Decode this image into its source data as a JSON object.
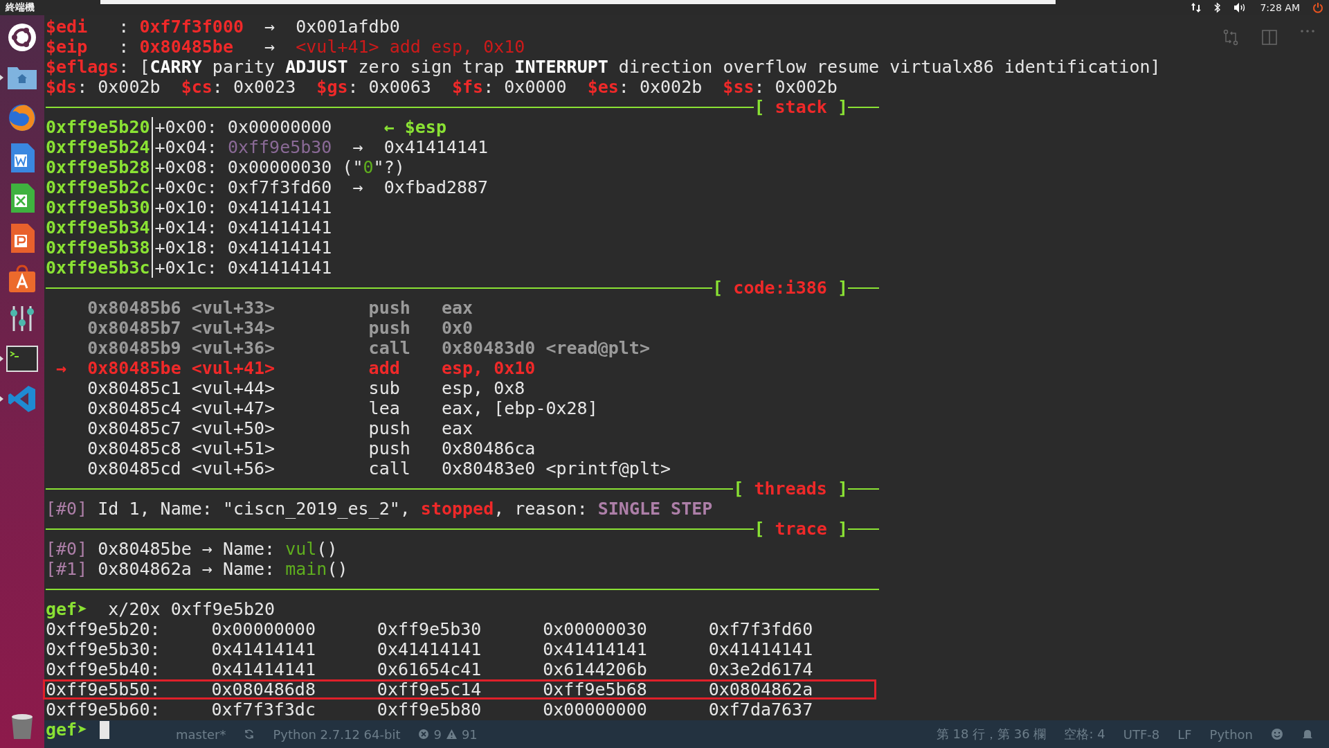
{
  "top_bar": {
    "title": "終端機",
    "clock": "7:28 AM"
  },
  "dock": [
    {
      "kind": "ubuntu",
      "running": false
    },
    {
      "kind": "files",
      "running": true
    },
    {
      "kind": "browser",
      "running": false
    },
    {
      "kind": "writer",
      "running": false
    },
    {
      "kind": "sheet",
      "running": false
    },
    {
      "kind": "slides",
      "running": false
    },
    {
      "kind": "store",
      "running": false
    },
    {
      "kind": "mixer",
      "running": false
    },
    {
      "kind": "terminal",
      "running": true
    },
    {
      "kind": "code",
      "running": true
    },
    {
      "kind": "trash",
      "running": false
    }
  ],
  "terminal": {
    "lines": [
      {
        "kind": "text",
        "segments": [
          {
            "t": "$edi",
            "kind": "reg"
          },
          {
            "t": "   : ",
            "kind": "val"
          },
          {
            "t": "0xf7f3f000",
            "kind": "reg"
          },
          {
            "t": "  →  ",
            "kind": "val"
          },
          {
            "t": "0x001afdb0",
            "kind": "val"
          }
        ]
      },
      {
        "kind": "text",
        "segments": [
          {
            "t": "$eip",
            "kind": "reg"
          },
          {
            "t": "   : ",
            "kind": "val"
          },
          {
            "t": "0x80485be",
            "kind": "reg"
          },
          {
            "t": "   →  ",
            "kind": "val"
          },
          {
            "t": "<vul+41> add esp, 0x10",
            "kind": "dred"
          }
        ]
      },
      {
        "kind": "text",
        "segments": [
          {
            "t": "$eflags",
            "kind": "reg"
          },
          {
            "t": ": [",
            "kind": "val"
          },
          {
            "t": "CARRY",
            "kind": "bold"
          },
          {
            "t": " parity ",
            "kind": "val"
          },
          {
            "t": "ADJUST",
            "kind": "bold"
          },
          {
            "t": " zero sign trap ",
            "kind": "val"
          },
          {
            "t": "INTERRUPT",
            "kind": "bold"
          },
          {
            "t": " direction overflow resume virtualx86 identification]",
            "kind": "val"
          }
        ]
      },
      {
        "kind": "text",
        "segments": [
          {
            "t": "$ds",
            "kind": "reg"
          },
          {
            "t": ": 0x002b  ",
            "kind": "val"
          },
          {
            "t": "$cs",
            "kind": "reg"
          },
          {
            "t": ": 0x0023  ",
            "kind": "val"
          },
          {
            "t": "$gs",
            "kind": "reg"
          },
          {
            "t": ": 0x0063  ",
            "kind": "val"
          },
          {
            "t": "$fs",
            "kind": "reg"
          },
          {
            "t": ": 0x0000  ",
            "kind": "val"
          },
          {
            "t": "$es",
            "kind": "reg"
          },
          {
            "t": ": 0x002b  ",
            "kind": "val"
          },
          {
            "t": "$ss",
            "kind": "reg"
          },
          {
            "t": ": 0x002b",
            "kind": "val"
          }
        ]
      },
      {
        "kind": "separator",
        "open": "[",
        "title": "stack",
        "close": "]"
      },
      {
        "kind": "stack",
        "address": "0xff9e5b20",
        "segments": [
          {
            "t": "+0x00: 0x00000000     ",
            "kind": "val"
          },
          {
            "t": "← $esp",
            "kind": "addr"
          }
        ]
      },
      {
        "kind": "stack",
        "address": "0xff9e5b24",
        "segments": [
          {
            "t": "+0x04: ",
            "kind": "val"
          },
          {
            "t": "0xff9e5b30",
            "kind": "ptr"
          },
          {
            "t": "  →  0x41414141",
            "kind": "val"
          }
        ]
      },
      {
        "kind": "stack",
        "address": "0xff9e5b28",
        "segments": [
          {
            "t": "+0x08: 0x00000030 (\"",
            "kind": "val"
          },
          {
            "t": "0",
            "kind": "str"
          },
          {
            "t": "\"?)",
            "kind": "val"
          }
        ]
      },
      {
        "kind": "stack",
        "address": "0xff9e5b2c",
        "segments": [
          {
            "t": "+0x0c: 0xf7f3fd60  →  0xfbad2887",
            "kind": "val"
          }
        ]
      },
      {
        "kind": "stack",
        "address": "0xff9e5b30",
        "segments": [
          {
            "t": "+0x10: 0x41414141",
            "kind": "val"
          }
        ]
      },
      {
        "kind": "stack",
        "address": "0xff9e5b34",
        "segments": [
          {
            "t": "+0x14: 0x41414141",
            "kind": "val"
          }
        ]
      },
      {
        "kind": "stack",
        "address": "0xff9e5b38",
        "segments": [
          {
            "t": "+0x18: 0x41414141",
            "kind": "val"
          }
        ]
      },
      {
        "kind": "stack",
        "address": "0xff9e5b3c",
        "segments": [
          {
            "t": "+0x1c: 0x41414141",
            "kind": "val"
          }
        ]
      },
      {
        "kind": "separator",
        "open": "[",
        "title": "code:i386",
        "close": "]"
      },
      {
        "kind": "text",
        "segments": [
          {
            "t": "    0x80485b6 <vul+33>         push   eax",
            "kind": "old"
          }
        ]
      },
      {
        "kind": "text",
        "segments": [
          {
            "t": "    0x80485b7 <vul+34>         push   0x0",
            "kind": "old"
          }
        ]
      },
      {
        "kind": "text",
        "segments": [
          {
            "t": "    0x80485b9 <vul+36>         call   0x80483d0 <read@plt>",
            "kind": "old"
          }
        ]
      },
      {
        "kind": "text",
        "segments": [
          {
            "t": " →  ",
            "kind": "cur"
          },
          {
            "t": "0x80485be <vul+41>         add    esp, 0x10",
            "kind": "cur"
          }
        ]
      },
      {
        "kind": "text",
        "segments": [
          {
            "t": "    0x80485c1 <vul+44>         sub    esp, 0x8",
            "kind": "val"
          }
        ]
      },
      {
        "kind": "text",
        "segments": [
          {
            "t": "    0x80485c4 <vul+47>         lea    eax, [ebp-0x28]",
            "kind": "val"
          }
        ]
      },
      {
        "kind": "text",
        "segments": [
          {
            "t": "    0x80485c7 <vul+50>         push   eax",
            "kind": "val"
          }
        ]
      },
      {
        "kind": "text",
        "segments": [
          {
            "t": "    0x80485c8 <vul+51>         push   0x80486ca",
            "kind": "val"
          }
        ]
      },
      {
        "kind": "text",
        "segments": [
          {
            "t": "    0x80485cd <vul+56>         call   0x80483e0 <printf@plt>",
            "kind": "val"
          }
        ]
      },
      {
        "kind": "separator",
        "open": "[",
        "title": "threads",
        "close": "]"
      },
      {
        "kind": "text",
        "segments": [
          {
            "t": "[#0]",
            "kind": "idx"
          },
          {
            "t": " Id 1, Name: \"ciscn_2019_es_2\", ",
            "kind": "val"
          },
          {
            "t": "stopped",
            "kind": "reg"
          },
          {
            "t": ", reason: ",
            "kind": "val"
          },
          {
            "t": "SINGLE STEP",
            "kind": "step"
          }
        ]
      },
      {
        "kind": "separator",
        "open": "[",
        "title": "trace",
        "close": "]"
      },
      {
        "kind": "text",
        "segments": [
          {
            "t": "[#0]",
            "kind": "idx"
          },
          {
            "t": " 0x80485be → Name: ",
            "kind": "val"
          },
          {
            "t": "vul",
            "kind": "str"
          },
          {
            "t": "()",
            "kind": "val"
          }
        ]
      },
      {
        "kind": "text",
        "segments": [
          {
            "t": "[#1]",
            "kind": "idx"
          },
          {
            "t": " 0x804862a → Name: ",
            "kind": "val"
          },
          {
            "t": "main",
            "kind": "str"
          },
          {
            "t": "()",
            "kind": "val"
          }
        ]
      },
      {
        "kind": "separator"
      },
      {
        "kind": "prompt",
        "prompt": "gef➤",
        "command": "  x/20x 0xff9e5b20",
        "cursor": false
      },
      {
        "kind": "memory",
        "address": "0xff9e5b20:",
        "values": [
          "0x00000000",
          "0xff9e5b30",
          "0x00000030",
          "0xf7f3fd60"
        ],
        "highlighted": false
      },
      {
        "kind": "memory",
        "address": "0xff9e5b30:",
        "values": [
          "0x41414141",
          "0x41414141",
          "0x41414141",
          "0x41414141"
        ],
        "highlighted": false
      },
      {
        "kind": "memory",
        "address": "0xff9e5b40:",
        "values": [
          "0x41414141",
          "0x61654c41",
          "0x6144206b",
          "0x3e2d6174"
        ],
        "highlighted": false
      },
      {
        "kind": "memory",
        "address": "0xff9e5b50:",
        "values": [
          "0x080486d8",
          "0xff9e5c14",
          "0xff9e5b68",
          "0x0804862a"
        ],
        "highlighted": true
      },
      {
        "kind": "memory",
        "address": "0xff9e5b60:",
        "values": [
          "0xf7f3f3dc",
          "0xff9e5b80",
          "0x00000000",
          "0xf7da7637"
        ],
        "highlighted": false
      },
      {
        "kind": "prompt",
        "prompt": "gef➤",
        "cursor": true
      }
    ]
  },
  "status_bar": {
    "branch": "master*",
    "interpreter": "Python 2.7.12 64-bit",
    "errors": "9",
    "warnings": "91",
    "position": "第 18 行，第 36 欄",
    "indent": "空格: 4",
    "encoding": "UTF-8",
    "eol": "LF",
    "language": "Python"
  }
}
